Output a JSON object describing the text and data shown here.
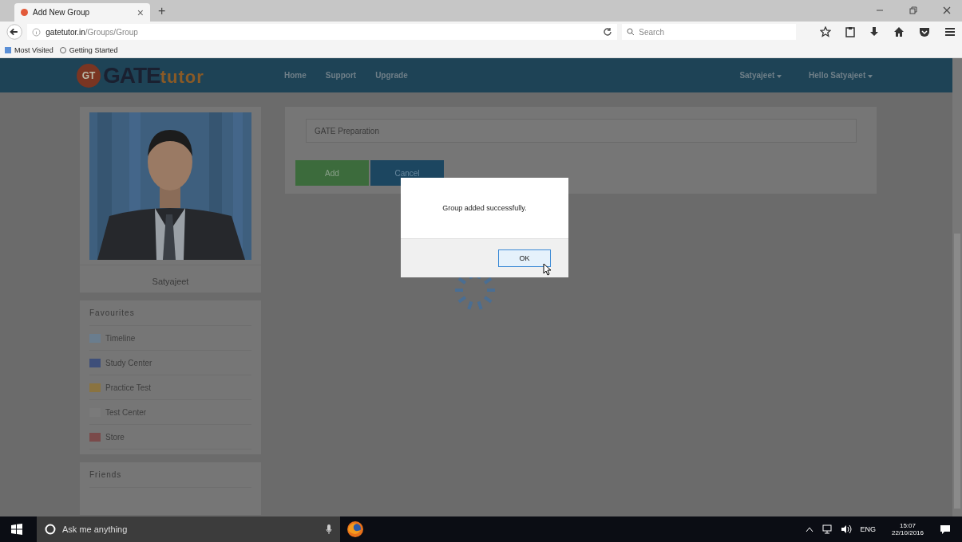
{
  "browser": {
    "tab_title": "Add New Group",
    "tab_close": "×",
    "new_tab": "+",
    "url_host": "gatetutor.in",
    "url_path": "/Groups/Group",
    "search_placeholder": "Search",
    "bookmarks": [
      "Most Visited",
      "Getting Started"
    ]
  },
  "site_header": {
    "logo_badge": "GT",
    "logo_main": "GATE",
    "logo_accent": "tutor",
    "nav": [
      "Home",
      "Support",
      "Upgrade"
    ],
    "menus": [
      "Satyajeet",
      "Hello Satyajeet"
    ]
  },
  "profile": {
    "kind": "picture",
    "name": "Satyajeet"
  },
  "favourites": {
    "title": "Favourites",
    "items": [
      {
        "label": "Timeline",
        "kind": "timeline"
      },
      {
        "label": "Study Center",
        "kind": "study"
      },
      {
        "label": "Practice Test",
        "kind": "practice"
      },
      {
        "label": "Test Center",
        "kind": "test"
      },
      {
        "label": "Store",
        "kind": "store"
      }
    ]
  },
  "friends": {
    "title": "Friends"
  },
  "group_form": {
    "value": "GATE Preparation",
    "buttons": [
      {
        "label": "Add",
        "kind": "add"
      },
      {
        "label": "Cancel",
        "kind": "cancel"
      }
    ]
  },
  "dialog": {
    "message": "Group added successfully.",
    "button": "OK"
  },
  "taskbar": {
    "search_placeholder": "Ask me anything",
    "language": "ENG",
    "time": "15:07",
    "date": "22/10/2016"
  }
}
